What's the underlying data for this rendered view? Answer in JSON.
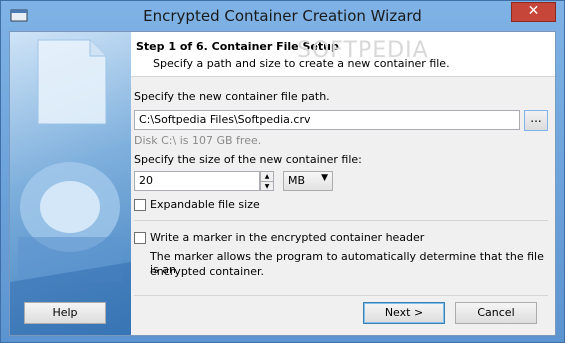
{
  "window": {
    "title": "Encrypted Container Creation Wizard",
    "close_glyph": "✕"
  },
  "header": {
    "step_title": "Step 1 of 6. Container File Setup",
    "subtitle": "Specify a path and size to create a new container file.",
    "watermark": "SOFTPEDIA"
  },
  "path": {
    "label": "Specify the new container file path.",
    "value": "C:\\Softpedia Files\\Softpedia.crv",
    "browse_label": "...",
    "disk_info": "Disk C:\\ is 107 GB free."
  },
  "size": {
    "label": "Specify the size of the new container file:",
    "value": "20",
    "unit": "MB",
    "unit_options": [
      "MB"
    ]
  },
  "expandable": {
    "label": "Expandable file size",
    "checked": false
  },
  "marker": {
    "label": "Write a marker in the encrypted container header",
    "checked": false,
    "description_line1": "The marker allows the program to automatically determine that the file is an",
    "description_line2": "encrypted container."
  },
  "buttons": {
    "help": "Help",
    "next": "Next >",
    "cancel": "Cancel"
  },
  "icons": {
    "app": "app-window-icon",
    "close": "close-icon",
    "browse": "ellipsis",
    "spin_up": "▲",
    "spin_down": "▼",
    "dropdown": "▼"
  },
  "colors": {
    "titlebar": "#7fb3e6",
    "close_button": "#c7463a",
    "default_button_border": "#3c7fb1"
  }
}
